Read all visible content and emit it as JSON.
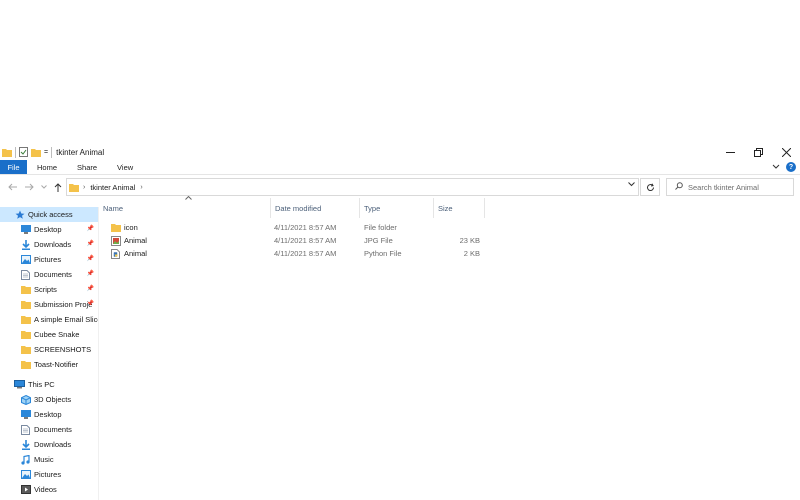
{
  "window": {
    "title": "tkinter Animal",
    "qa_dropdown": "="
  },
  "ribbon": {
    "tabs": [
      {
        "label": "File"
      },
      {
        "label": "Home"
      },
      {
        "label": "Share"
      },
      {
        "label": "View"
      }
    ],
    "expand_icon": "chevron-down-icon",
    "help_label": "?"
  },
  "nav": {
    "address_path": "tkinter Animal",
    "search_placeholder": "Search tkinter Animal"
  },
  "sidebar": {
    "quick_access": {
      "label": "Quick access",
      "items": [
        {
          "label": "Desktop",
          "icon": "desktop-icon",
          "pinned": true
        },
        {
          "label": "Downloads",
          "icon": "downloads-icon",
          "pinned": true
        },
        {
          "label": "Pictures",
          "icon": "pictures-icon",
          "pinned": true
        },
        {
          "label": "Documents",
          "icon": "documents-icon",
          "pinned": true
        },
        {
          "label": "Scripts",
          "icon": "folder-icon",
          "pinned": true
        },
        {
          "label": "Submission Proje",
          "icon": "folder-icon",
          "pinned": true
        },
        {
          "label": "A simple Email Slice",
          "icon": "folder-icon",
          "pinned": false
        },
        {
          "label": "Cubee Snake",
          "icon": "folder-icon",
          "pinned": false
        },
        {
          "label": "SCREENSHOTS",
          "icon": "folder-icon",
          "pinned": false
        },
        {
          "label": "Toast-Notifier",
          "icon": "folder-icon",
          "pinned": false
        }
      ]
    },
    "this_pc": {
      "label": "This PC",
      "items": [
        {
          "label": "3D Objects",
          "icon": "3d-objects-icon"
        },
        {
          "label": "Desktop",
          "icon": "desktop-icon"
        },
        {
          "label": "Documents",
          "icon": "documents-icon"
        },
        {
          "label": "Downloads",
          "icon": "downloads-icon"
        },
        {
          "label": "Music",
          "icon": "music-icon"
        },
        {
          "label": "Pictures",
          "icon": "pictures-icon"
        },
        {
          "label": "Videos",
          "icon": "videos-icon"
        }
      ]
    }
  },
  "file_list": {
    "columns": [
      "Name",
      "Date modified",
      "Type",
      "Size"
    ],
    "rows": [
      {
        "name": "icon",
        "date": "4/11/2021 8:57 AM",
        "type": "File folder",
        "size": "",
        "icon": "folder-icon"
      },
      {
        "name": "Animal",
        "date": "4/11/2021 8:57 AM",
        "type": "JPG File",
        "size": "23 KB",
        "icon": "jpg-file-icon"
      },
      {
        "name": "Animal",
        "date": "4/11/2021 8:57 AM",
        "type": "Python File",
        "size": "2 KB",
        "icon": "python-file-icon"
      }
    ]
  },
  "colors": {
    "accent": "#1a6fc9",
    "selection": "#cce8ff",
    "folder": "#f4c24a",
    "header_text": "#4c607a"
  }
}
